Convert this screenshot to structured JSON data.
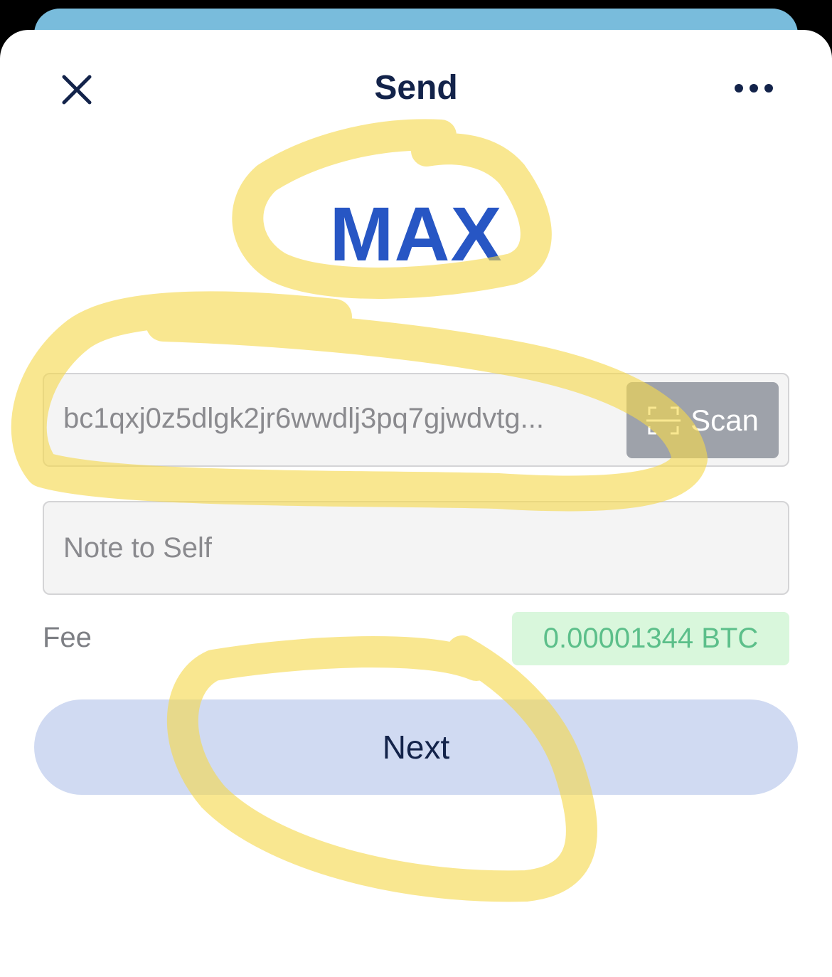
{
  "header": {
    "title": "Send",
    "close_icon": "close-icon",
    "more_icon": "more-horizontal-icon"
  },
  "amount": {
    "value": "MAX"
  },
  "address_field": {
    "value": "bc1qxj0z5dlgk2jr6wwdlj3pq7gjwdvtg...",
    "scan_label": "Scan",
    "scan_icon": "scan-icon"
  },
  "note_field": {
    "placeholder": "Note to Self"
  },
  "fee": {
    "label": "Fee",
    "value": "0.00001344 BTC"
  },
  "actions": {
    "next_label": "Next"
  },
  "colors": {
    "amount": "#2756c4",
    "title": "#13234a",
    "next_button_bg": "#d0daf2",
    "fee_badge_bg": "#d9f7dc",
    "fee_badge_text": "#5cbf8a",
    "highlighter": "#f6d84c"
  }
}
